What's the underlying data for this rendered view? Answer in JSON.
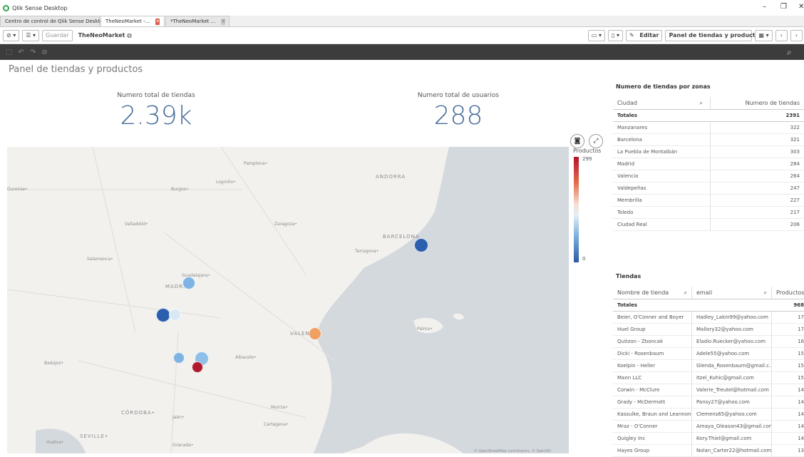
{
  "window": {
    "title": "Qlik Sense Desktop",
    "minimize": "–",
    "restore": "❐",
    "close": "✕"
  },
  "tabs": [
    {
      "label": "Centro de control de Qlik Sense Desktop",
      "closable": false,
      "active": false
    },
    {
      "label": "TheNeoMarket -...",
      "closable": true,
      "active": true
    },
    {
      "label": "*TheNeoMarket ...",
      "closable": true,
      "active": false
    }
  ],
  "toolbar": {
    "guardar": "Guardar",
    "app_name": "TheNeoMarket",
    "editar": "Editar",
    "sheet_selector": "Panel de tiendas y productos"
  },
  "sheet": {
    "title": "Panel de tiendas y productos"
  },
  "kpis": [
    {
      "label": "Numero total de tiendas",
      "value": "2.39k"
    },
    {
      "label": "Numero total de usuarios",
      "value": "288"
    }
  ],
  "map": {
    "places": [
      {
        "name": "Pamplona•"
      },
      {
        "name": "Logroño•"
      },
      {
        "name": "Burgos•"
      },
      {
        "name": "ANDORRA"
      },
      {
        "name": "Ourense•"
      },
      {
        "name": "Zaragoza•"
      },
      {
        "name": "Valladolid•"
      },
      {
        "name": "BARCELONA"
      },
      {
        "name": "Tarragona•"
      },
      {
        "name": "Salamanca•"
      },
      {
        "name": "Guadalajara•"
      },
      {
        "name": "MADRID"
      },
      {
        "name": "VALENCIA"
      },
      {
        "name": "Palma•"
      },
      {
        "name": "Albacete•"
      },
      {
        "name": "Badajoz•"
      },
      {
        "name": "Murcia•"
      },
      {
        "name": "CÓRDOBA•"
      },
      {
        "name": "Jaén•"
      },
      {
        "name": "Cartagena•"
      },
      {
        "name": "SEVILLE•"
      },
      {
        "name": "Huelva•"
      },
      {
        "name": "Granada•"
      }
    ],
    "attribution": "© OpenStreetMap contributors, © OpenSD",
    "bubble_colors": [
      "#2b5fae",
      "#7eb3e3",
      "#2b5fae",
      "#d8e8f5",
      "#f0a060",
      "#7eb3e3",
      "#8fc0e8",
      "#b01a2e"
    ]
  },
  "legend": {
    "title": "Productos",
    "max": "299",
    "min": "0"
  },
  "zonas": {
    "title": "Numero de tiendas por zonas",
    "headers": {
      "ciudad": "Ciudad",
      "numero": "Numero de tiendas"
    },
    "totals": {
      "label": "Totales",
      "value": "2391"
    },
    "rows": [
      {
        "ciudad": "Manzanares",
        "n": "322"
      },
      {
        "ciudad": "Barcelona",
        "n": "321"
      },
      {
        "ciudad": "La Puebla de Montalbán",
        "n": "303"
      },
      {
        "ciudad": "Madrid",
        "n": "284"
      },
      {
        "ciudad": "Valencia",
        "n": "264"
      },
      {
        "ciudad": "Valdepeñas",
        "n": "247"
      },
      {
        "ciudad": "Membrilla",
        "n": "227"
      },
      {
        "ciudad": "Toledo",
        "n": "217"
      },
      {
        "ciudad": "Ciudad Real",
        "n": "206"
      }
    ]
  },
  "tiendas": {
    "title": "Tiendas",
    "headers": {
      "nombre": "Nombre de tienda",
      "email": "email",
      "productos": "Productos"
    },
    "totals": {
      "label": "Totales",
      "value": "968"
    },
    "rows": [
      {
        "nombre": "Beier, O'Conner and Boyer",
        "email": "Hadley_Lakin99@yahoo.com",
        "p": "17"
      },
      {
        "nombre": "Huel Group",
        "email": "Mallory32@yahoo.com",
        "p": "17"
      },
      {
        "nombre": "Quitzon - Zboncak",
        "email": "Eladio.Ruecker@yahoo.com",
        "p": "16"
      },
      {
        "nombre": "Dicki - Rosenbaum",
        "email": "Adele55@yahoo.com",
        "p": "15"
      },
      {
        "nombre": "Koelpin - Heller",
        "email": "Glenda_Rosenbaum@gmail.c...",
        "p": "15"
      },
      {
        "nombre": "Mann LLC",
        "email": "Itzel_Kuhic@gmail.com",
        "p": "15"
      },
      {
        "nombre": "Corwin - McClure",
        "email": "Valerie_Treutel@hotmail.com",
        "p": "14"
      },
      {
        "nombre": "Grady - McDermott",
        "email": "Pansy27@yahoo.com",
        "p": "14"
      },
      {
        "nombre": "Kassulke, Braun and Leannon",
        "email": "Clemens65@yahoo.com",
        "p": "14"
      },
      {
        "nombre": "Mraz - O'Conner",
        "email": "Amaya_Gleason43@gmail.com",
        "p": "14"
      },
      {
        "nombre": "Quigley Inc",
        "email": "Kory.Thiel@gmail.com",
        "p": "14"
      },
      {
        "nombre": "Hayes Group",
        "email": "Nolan_Carter22@hotmail.com",
        "p": "13"
      }
    ]
  }
}
